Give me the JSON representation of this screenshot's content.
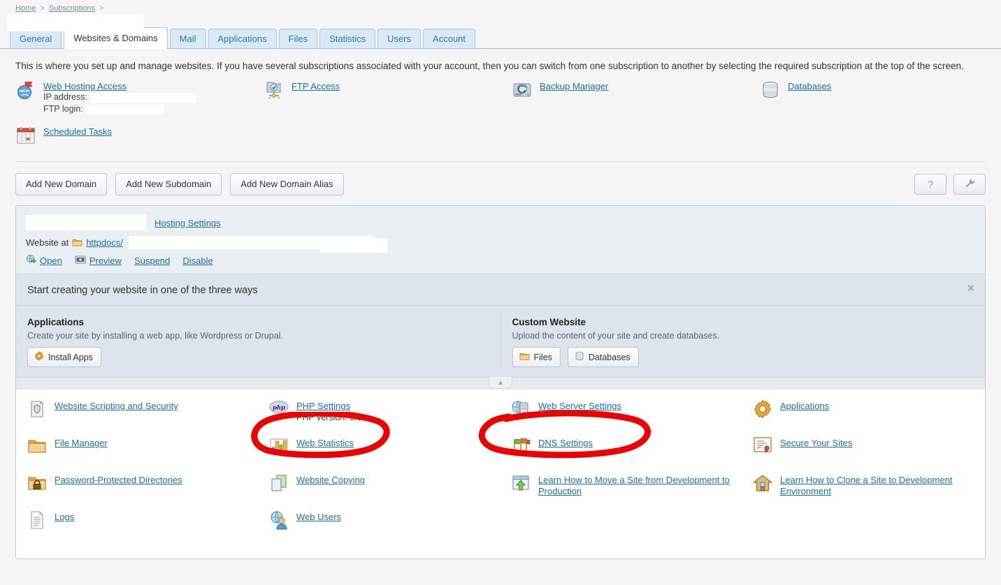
{
  "breadcrumb": {
    "home": "Home",
    "subscriptions": "Subscriptions",
    "sep": ">"
  },
  "tabs": [
    {
      "label": "General",
      "active": false
    },
    {
      "label": "Websites & Domains",
      "active": true
    },
    {
      "label": "Mail",
      "active": false
    },
    {
      "label": "Applications",
      "active": false
    },
    {
      "label": "Files",
      "active": false
    },
    {
      "label": "Statistics",
      "active": false
    },
    {
      "label": "Users",
      "active": false
    },
    {
      "label": "Account",
      "active": false
    }
  ],
  "intro": "This is where you set up and manage websites. If you have several subscriptions associated with your account, then you can switch from one subscription to another by selecting the required subscription at the top of the screen.",
  "shortcuts": {
    "web_hosting_access": {
      "label": "Web Hosting Access",
      "icon": "globe-flag-icon",
      "ip_label": "IP address:",
      "ftp_label": "FTP login:"
    },
    "ftp_access": {
      "label": "FTP Access",
      "icon": "ftp-access-icon"
    },
    "backup_manager": {
      "label": "Backup Manager",
      "icon": "backup-disk-icon"
    },
    "databases": {
      "label": "Databases",
      "icon": "database-icon"
    },
    "scheduled_tasks": {
      "label": "Scheduled Tasks",
      "icon": "calendar-icon"
    }
  },
  "toolbar": {
    "add_new_domain": "Add New Domain",
    "add_new_subdomain": "Add New Subdomain",
    "add_new_domain_alias": "Add New Domain Alias",
    "help_label": "?",
    "help_icon": "question-mark-icon",
    "tools_icon": "wrench-icon"
  },
  "domain_panel": {
    "hosting_settings": "Hosting Settings",
    "website_at_label": "Website at",
    "folder_icon": "folder-icon",
    "httpdocs": "httpdocs/",
    "actions": [
      {
        "label": "Open",
        "icon": "open-globe-icon"
      },
      {
        "label": "Preview",
        "icon": "preview-window-icon"
      },
      {
        "label": "Suspend",
        "icon": ""
      },
      {
        "label": "Disable",
        "icon": ""
      }
    ]
  },
  "promo": {
    "title": "Start creating your website in one of the three ways",
    "close_icon": "close-icon",
    "collapse_icon": "chevron-up-icon",
    "left": {
      "heading": "Applications",
      "desc": "Create your site by installing a web app, like Wordpress or Drupal.",
      "buttons": [
        {
          "label": "Install Apps",
          "icon": "gear-orange-icon"
        }
      ]
    },
    "right": {
      "heading": "Custom Website",
      "desc": "Upload the content of your site and create databases.",
      "buttons": [
        {
          "label": "Files",
          "icon": "folder-icon"
        },
        {
          "label": "Databases",
          "icon": "database-icon"
        }
      ]
    }
  },
  "links": {
    "col1": [
      {
        "label": "Website Scripting and Security",
        "icon": "shield-document-icon",
        "sub": ""
      },
      {
        "label": "File Manager",
        "icon": "folder-icon",
        "sub": ""
      },
      {
        "label": "Password-Protected Directories",
        "icon": "folder-lock-icon",
        "sub": ""
      },
      {
        "label": "Logs",
        "icon": "log-document-icon",
        "sub": ""
      }
    ],
    "col2": [
      {
        "label": "PHP Settings",
        "icon": "php-icon",
        "sub": "PHP version: 5.3"
      },
      {
        "label": "Web Statistics",
        "icon": "bar-chart-icon",
        "sub": ""
      },
      {
        "label": "Website Copying",
        "icon": "copy-pages-icon",
        "sub": ""
      },
      {
        "label": "Web Users",
        "icon": "web-users-icon",
        "sub": ""
      }
    ],
    "col3": [
      {
        "label": "Web Server Settings",
        "icon": "web-server-icon",
        "sub": ""
      },
      {
        "label": "DNS Settings",
        "icon": "dns-flags-icon",
        "sub": ""
      },
      {
        "label": "Learn How to Move a Site from Development to Production",
        "icon": "upload-window-icon",
        "sub": ""
      }
    ],
    "col4": [
      {
        "label": "Applications",
        "icon": "gear-orange-icon",
        "sub": ""
      },
      {
        "label": "Secure Your Sites",
        "icon": "certificate-icon",
        "sub": ""
      },
      {
        "label": "Learn How to Clone a Site to Development Environment",
        "icon": "house-icon",
        "sub": ""
      }
    ]
  },
  "annotations": {
    "color": "#ee0000",
    "marks": [
      {
        "target": "PHP Settings",
        "shape": "hand-drawn-ellipse"
      },
      {
        "target": "Web Server Settings",
        "shape": "hand-drawn-ellipse"
      }
    ]
  }
}
